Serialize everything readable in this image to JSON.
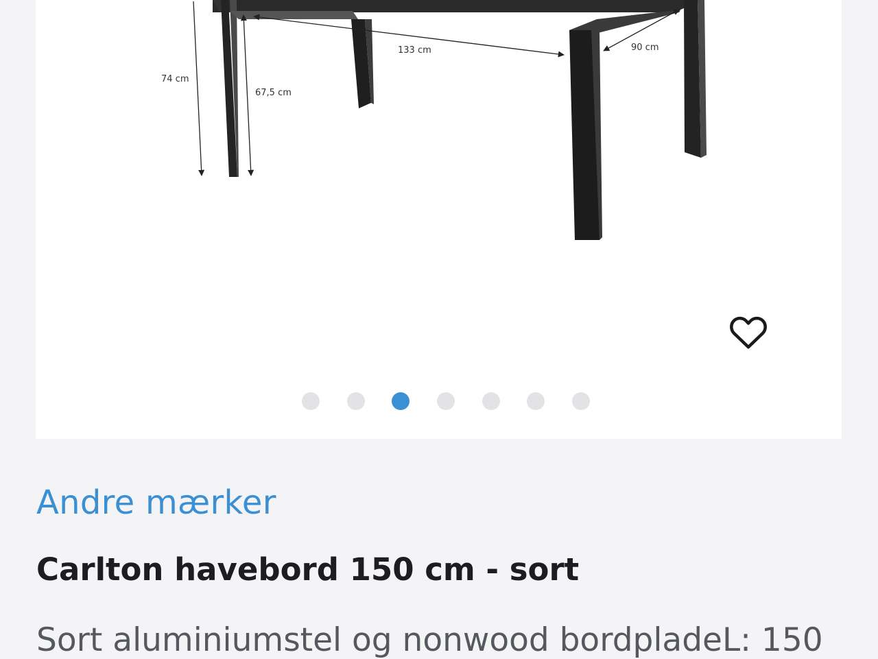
{
  "gallery": {
    "drawing_alt": "Carlton havebord målskitse",
    "dimensions": {
      "total_height": "74 cm",
      "leg_height": "67,5 cm",
      "inner_length": "133 cm",
      "inner_width": "90 cm"
    },
    "favorite_icon": "heart-outline-icon",
    "dots_count": 7,
    "active_dot": 2,
    "colors": {
      "active_dot": "#3b8fd3",
      "inactive_dot": "#e3e3e6"
    }
  },
  "product": {
    "brand": "Andre mærker",
    "title": "Carlton havebord 150 cm - sort",
    "description": "Sort aluminiumstel og nonwood bordpladeL: 150"
  },
  "colors": {
    "link": "#3b8fd3",
    "title": "#1d1d1f",
    "body_text": "#55585e",
    "background": "#f4f4f6"
  }
}
